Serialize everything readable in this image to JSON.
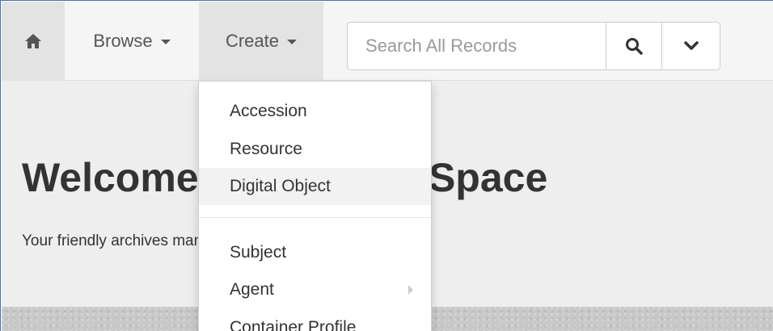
{
  "navbar": {
    "home_icon": "home-icon",
    "browse_label": "Browse",
    "create_label": "Create",
    "search": {
      "placeholder": "Search All Records",
      "value": "",
      "search_icon": "search-icon",
      "expand_icon": "chevron-down-icon"
    }
  },
  "create_menu": {
    "items": [
      {
        "label": "Accession"
      },
      {
        "label": "Resource"
      },
      {
        "label": "Digital Object",
        "highlighted": true
      },
      {
        "label": "Subject"
      },
      {
        "label": "Agent",
        "has_submenu": true
      },
      {
        "label": "Container Profile"
      }
    ]
  },
  "jumbotron": {
    "title": "Welcome to ArchivesSpace",
    "subtitle": "Your friendly archives management tool."
  },
  "colors": {
    "nav_background": "#f5f5f5",
    "active_nav": "#e3e3e3",
    "frame_border": "#3b73b9",
    "text": "#333333"
  }
}
